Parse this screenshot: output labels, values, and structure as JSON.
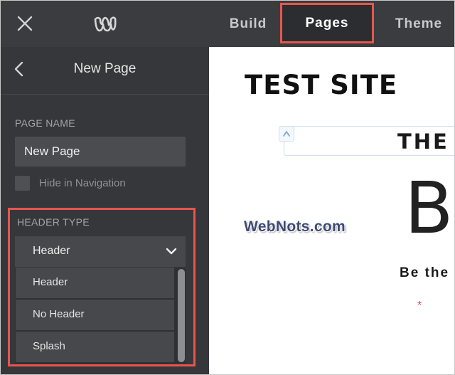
{
  "topbar": {
    "tabs": [
      "Build",
      "Pages",
      "Theme"
    ],
    "active_tab": "Pages",
    "logo_icon": "weebly-w-logo"
  },
  "sidebar": {
    "title": "New Page",
    "page_name_label": "PAGE NAME",
    "page_name_value": "New Page",
    "hide_nav_label": "Hide in Navigation",
    "hide_nav_checked": false,
    "header_type_label": "HEADER TYPE",
    "header_type_selected": "Header",
    "header_type_options": [
      "Header",
      "No Header",
      "Splash"
    ]
  },
  "preview": {
    "site_title": "TEST SITE",
    "headline": "THE",
    "big_letter": "B",
    "tagline": "Be the",
    "asterisk": "*"
  },
  "watermark": "WebNots.com",
  "colors": {
    "highlight": "#e8554e",
    "topbar_bg": "#3a3c3f",
    "sidebar_bg": "#35373a"
  }
}
